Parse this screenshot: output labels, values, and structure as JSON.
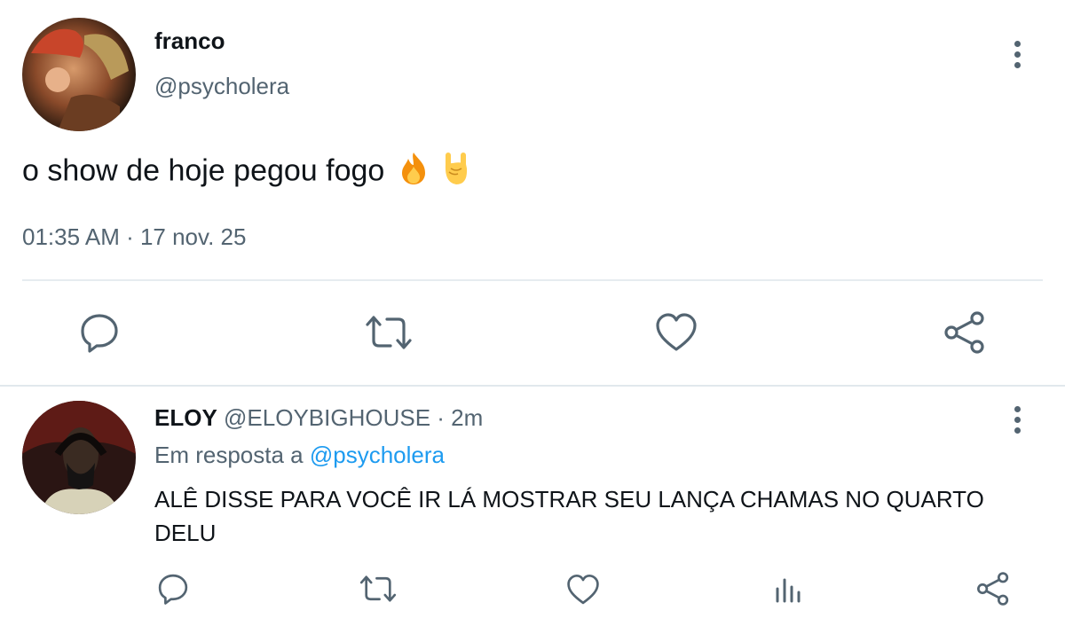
{
  "main_tweet": {
    "display_name": "franco",
    "handle": "@psycholera",
    "text": "o show de hoje pegou fogo",
    "emojis": [
      "fire-emoji",
      "rock-hand-emoji"
    ],
    "timestamp": "01:35 AM · 17 nov. 25",
    "actions": [
      "reply-icon",
      "retweet-icon",
      "like-icon",
      "share-icon"
    ]
  },
  "reply": {
    "display_name": "ELOY",
    "handle": "@ELOYBIGHOUSE",
    "separator": " · ",
    "time": "2m",
    "reply_prefix": "Em resposta a ",
    "reply_to": "@psycholera",
    "text": "ALÊ DISSE PARA VOCÊ IR LÁ MOSTRAR SEU LANÇA CHAMAS NO QUARTO DELU",
    "actions": [
      "reply-icon",
      "retweet-icon",
      "like-icon",
      "analytics-icon",
      "share-icon"
    ]
  },
  "colors": {
    "text_primary": "#0f1419",
    "text_secondary": "#536471",
    "link": "#1d9bf0",
    "divider": "#e6ecf0"
  }
}
